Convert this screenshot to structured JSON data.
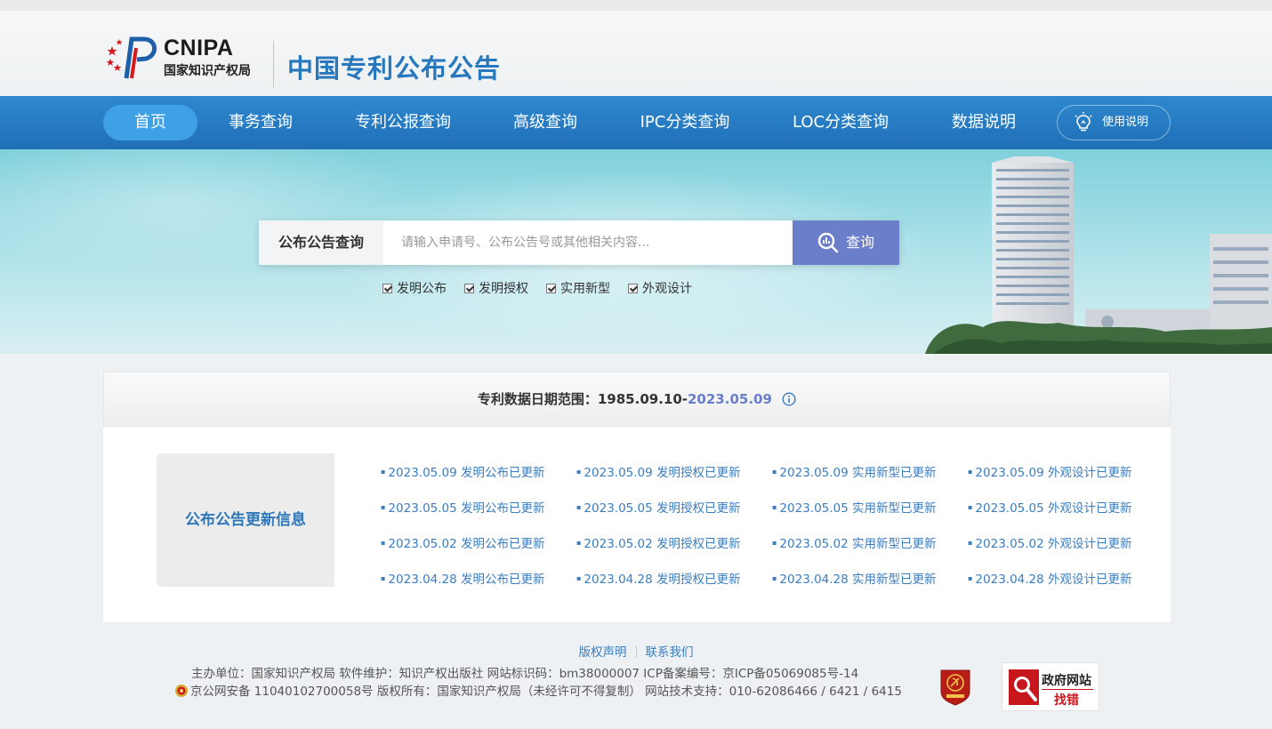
{
  "header": {
    "logo_text": "CNIPA",
    "logo_cn": "国家知识产权局",
    "site_title": "中国专利公布公告"
  },
  "nav": {
    "items": [
      {
        "label": "首页",
        "active": true
      },
      {
        "label": "事务查询"
      },
      {
        "label": "专利公报查询"
      },
      {
        "label": "高级查询"
      },
      {
        "label": "IPC分类查询"
      },
      {
        "label": "LOC分类查询"
      },
      {
        "label": "数据说明"
      }
    ],
    "help_label": "使用说明"
  },
  "search": {
    "label": "公布公告查询",
    "placeholder": "请输入申请号、公布公告号或其他相关内容...",
    "button_label": "查询",
    "checkboxes": [
      {
        "label": "发明公布",
        "checked": true
      },
      {
        "label": "发明授权",
        "checked": true
      },
      {
        "label": "实用新型",
        "checked": true
      },
      {
        "label": "外观设计",
        "checked": true
      }
    ]
  },
  "date_range": {
    "prefix": "专利数据日期范围：",
    "start": "1985.09.10-",
    "end": "2023.05.09"
  },
  "updates": {
    "title": "公布公告更新信息",
    "rows": [
      [
        "2023.05.09 发明公布已更新",
        "2023.05.09 发明授权已更新",
        "2023.05.09 实用新型已更新",
        "2023.05.09 外观设计已更新"
      ],
      [
        "2023.05.05 发明公布已更新",
        "2023.05.05 发明授权已更新",
        "2023.05.05 实用新型已更新",
        "2023.05.05 外观设计已更新"
      ],
      [
        "2023.05.02 发明公布已更新",
        "2023.05.02 发明授权已更新",
        "2023.05.02 实用新型已更新",
        "2023.05.02 外观设计已更新"
      ],
      [
        "2023.04.28 发明公布已更新",
        "2023.04.28 发明授权已更新",
        "2023.04.28 实用新型已更新",
        "2023.04.28 外观设计已更新"
      ]
    ]
  },
  "footer": {
    "copyright_link": "版权声明",
    "contact_link": "联系我们",
    "line1": "主办单位：国家知识产权局    软件维护：知识产权出版社    网站标识码：bm38000007    ICP备案编号：京ICP备05069085号-14",
    "line2_police": "京公网安备 11040102700058号",
    "line2_rest": "   版权所有：国家知识产权局（未经许可不得复制）    网站技术支持：010-62086466 / 6421 / 6415",
    "gov_badge_top": "政府网站",
    "gov_badge_bottom": "找错"
  },
  "colors": {
    "nav_bg": "#2379c0",
    "nav_active": "#3fa0e6",
    "title_blue": "#2778bd",
    "search_button": "#6b7ec9",
    "link_blue": "#3a7dbf"
  }
}
